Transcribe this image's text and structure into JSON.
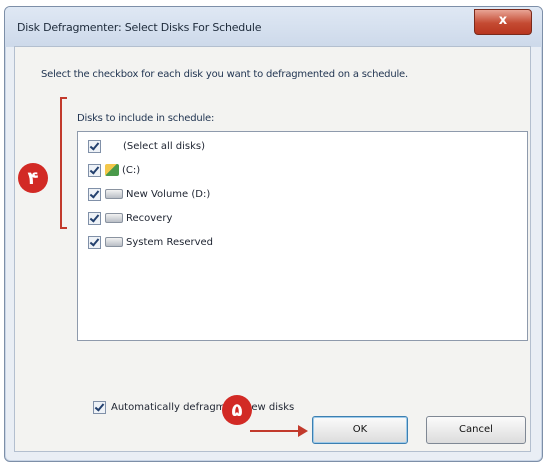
{
  "window": {
    "title": "Disk Defragmenter: Select Disks For Schedule",
    "close_label": "x"
  },
  "instruction": "Select the checkbox for each disk you want to defragmented on a schedule.",
  "list": {
    "label": "Disks to include in schedule:",
    "items": [
      {
        "label": "(Select all disks)",
        "checked": true,
        "icon": "none"
      },
      {
        "label": "(C:)",
        "checked": true,
        "icon": "system-drive-icon"
      },
      {
        "label": "New Volume (D:)",
        "checked": true,
        "icon": "drive-icon"
      },
      {
        "label": "Recovery",
        "checked": true,
        "icon": "drive-icon"
      },
      {
        "label": "System Reserved",
        "checked": true,
        "icon": "drive-icon"
      }
    ]
  },
  "auto_defrag": {
    "label": "Automatically defragment new disks",
    "checked": true
  },
  "buttons": {
    "ok": "OK",
    "cancel": "Cancel"
  },
  "annotations": {
    "badge_list": "۴",
    "badge_ok": "۵"
  },
  "colors": {
    "annotation_red": "#c23a2c"
  }
}
